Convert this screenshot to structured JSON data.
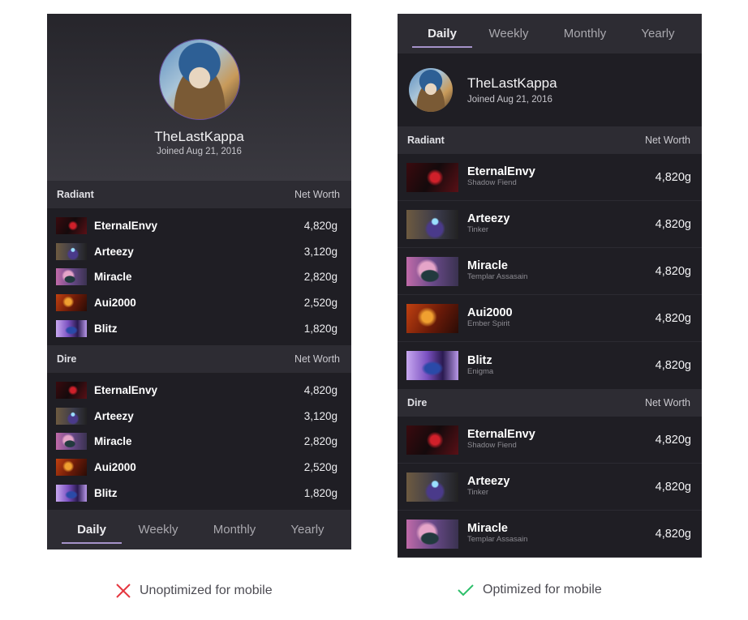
{
  "profile": {
    "username": "TheLastKappa",
    "joined": "Joined Aug 21, 2016"
  },
  "tabs": [
    "Daily",
    "Weekly",
    "Monthly",
    "Yearly"
  ],
  "active_tab": "Daily",
  "colors": {
    "accent_underline": "#a592c9",
    "background": "#1f1e24",
    "section_header": "#2d2c33",
    "cross": "#e5363f",
    "check": "#2dbf6a"
  },
  "unoptimized": {
    "radiant": {
      "team": "Radiant",
      "column": "Net Worth",
      "players": [
        {
          "name": "EternalEnvy",
          "net_worth": "4,820g",
          "hero": "shadow-fiend"
        },
        {
          "name": "Arteezy",
          "net_worth": "3,120g",
          "hero": "tinker"
        },
        {
          "name": "Miracle",
          "net_worth": "2,820g",
          "hero": "templar-assassin"
        },
        {
          "name": "Aui2000",
          "net_worth": "2,520g",
          "hero": "ember-spirit"
        },
        {
          "name": "Blitz",
          "net_worth": "1,820g",
          "hero": "enigma"
        }
      ]
    },
    "dire": {
      "team": "Dire",
      "column": "Net Worth",
      "players": [
        {
          "name": "EternalEnvy",
          "net_worth": "4,820g",
          "hero": "shadow-fiend"
        },
        {
          "name": "Arteezy",
          "net_worth": "3,120g",
          "hero": "tinker"
        },
        {
          "name": "Miracle",
          "net_worth": "2,820g",
          "hero": "templar-assassin"
        },
        {
          "name": "Aui2000",
          "net_worth": "2,520g",
          "hero": "ember-spirit"
        },
        {
          "name": "Blitz",
          "net_worth": "1,820g",
          "hero": "enigma"
        }
      ]
    },
    "caption": "Unoptimized for mobile"
  },
  "optimized": {
    "radiant": {
      "team": "Radiant",
      "column": "Net Worth",
      "players": [
        {
          "name": "EternalEnvy",
          "hero_name": "Shadow Fiend",
          "net_worth": "4,820g"
        },
        {
          "name": "Arteezy",
          "hero_name": "Tinker",
          "net_worth": "4,820g"
        },
        {
          "name": "Miracle",
          "hero_name": "Templar Assasain",
          "net_worth": "4,820g"
        },
        {
          "name": "Aui2000",
          "hero_name": "Ember Spirit",
          "net_worth": "4,820g"
        },
        {
          "name": "Blitz",
          "hero_name": "Enigma",
          "net_worth": "4,820g"
        }
      ]
    },
    "dire": {
      "team": "Dire",
      "column": "Net Worth",
      "players": [
        {
          "name": "EternalEnvy",
          "hero_name": "Shadow Fiend",
          "net_worth": "4,820g"
        },
        {
          "name": "Arteezy",
          "hero_name": "Tinker",
          "net_worth": "4,820g"
        },
        {
          "name": "Miracle",
          "hero_name": "Templar Assasain",
          "net_worth": "4,820g"
        }
      ]
    },
    "caption": "Optimized for mobile"
  }
}
